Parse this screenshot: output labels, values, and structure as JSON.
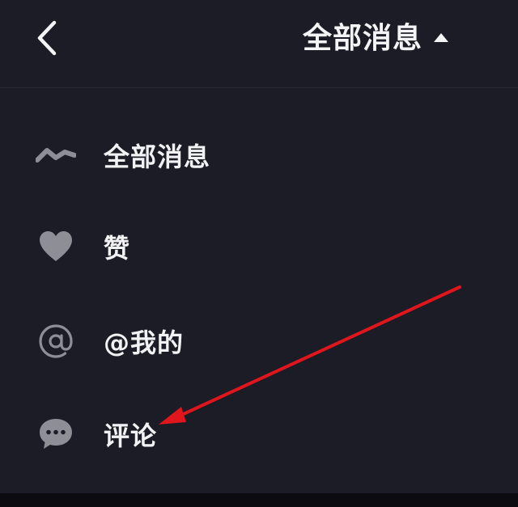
{
  "header": {
    "title": "全部消息",
    "back_icon": "chevron-left-icon",
    "caret_icon": "caret-up-icon"
  },
  "menu": {
    "items": [
      {
        "label": "全部消息",
        "icon": "activity-wave-icon"
      },
      {
        "label": "赞",
        "icon": "heart-icon"
      },
      {
        "label": "@我的",
        "icon": "at-sign-icon"
      },
      {
        "label": "评论",
        "icon": "comment-bubble-icon"
      }
    ]
  },
  "colors": {
    "background": "#1b1c25",
    "text": "#f2f2f4",
    "icon": "#8d8e96",
    "divider": "#2a2b35",
    "annotation_arrow": "#e0161c"
  }
}
